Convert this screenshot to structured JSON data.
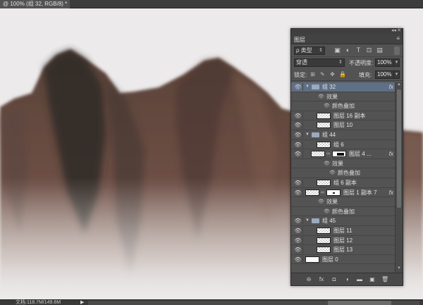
{
  "document": {
    "tab_title": "@ 100% (组 32, RGB/8) *"
  },
  "status": {
    "doc_size": "文档:118.7M/149.6M",
    "arrow": "▶"
  },
  "panel": {
    "title": "图层",
    "filter": {
      "label": "ρ 类型",
      "caret": "⇕"
    },
    "filter_icons": [
      "image-filter-icon",
      "adjustment-filter-icon",
      "type-filter-icon",
      "shape-filter-icon",
      "smart-object-filter-icon"
    ],
    "filter_glyphs": [
      "▣",
      "◐",
      "T",
      "⊡",
      "▤"
    ],
    "blend_mode": "穿透",
    "opacity_label": "不透明度:",
    "opacity_value": "100%",
    "lock_label": "锁定:",
    "lock_glyphs": [
      "⊞",
      "✎",
      "✥",
      "🔒"
    ],
    "fill_label": "填充:",
    "fill_value": "100%",
    "footer_glyphs": [
      "⊖",
      "fx",
      "◘",
      "◑",
      "▬",
      "▣",
      "🗑"
    ],
    "layers": [
      {
        "kind": "group",
        "name": "组 32",
        "indent": 0,
        "fx": "fx",
        "selected": true
      },
      {
        "kind": "effects",
        "name": "效果",
        "indent": 1
      },
      {
        "kind": "effect",
        "name": "颜色叠加",
        "indent": 2
      },
      {
        "kind": "layer",
        "name": "图层 16 副本",
        "indent": 1
      },
      {
        "kind": "layer",
        "name": "图层 10",
        "indent": 1
      },
      {
        "kind": "group",
        "name": "组 44",
        "indent": 0
      },
      {
        "kind": "layer",
        "name": "组 6",
        "indent": 1
      },
      {
        "kind": "masked",
        "name": "图层 4 ...",
        "indent": 1,
        "fx": "fx",
        "mask": "dark"
      },
      {
        "kind": "effects",
        "name": "效果",
        "indent": 2
      },
      {
        "kind": "effect",
        "name": "颜色叠加",
        "indent": 3
      },
      {
        "kind": "layer",
        "name": "组 6 副本",
        "indent": 1
      },
      {
        "kind": "masked",
        "name": "图层 1 副本 7",
        "indent": 0,
        "fx": "fx",
        "mask": "dot"
      },
      {
        "kind": "effects",
        "name": "效果",
        "indent": 1
      },
      {
        "kind": "effect",
        "name": "颜色叠加",
        "indent": 2
      },
      {
        "kind": "group",
        "name": "组 45",
        "indent": 0
      },
      {
        "kind": "layer",
        "name": "图层 11",
        "indent": 1
      },
      {
        "kind": "layer",
        "name": "图层 12",
        "indent": 1
      },
      {
        "kind": "layer",
        "name": "图层 13",
        "indent": 1
      },
      {
        "kind": "base",
        "name": "图层 0",
        "indent": 0
      }
    ]
  },
  "colors": {
    "canvas_bg": "#eceaea",
    "panel_bg": "#535353",
    "selected_row": "#5f6f86",
    "rock_dark": "#3a302c",
    "rock_brown": "#6b4a3e"
  }
}
